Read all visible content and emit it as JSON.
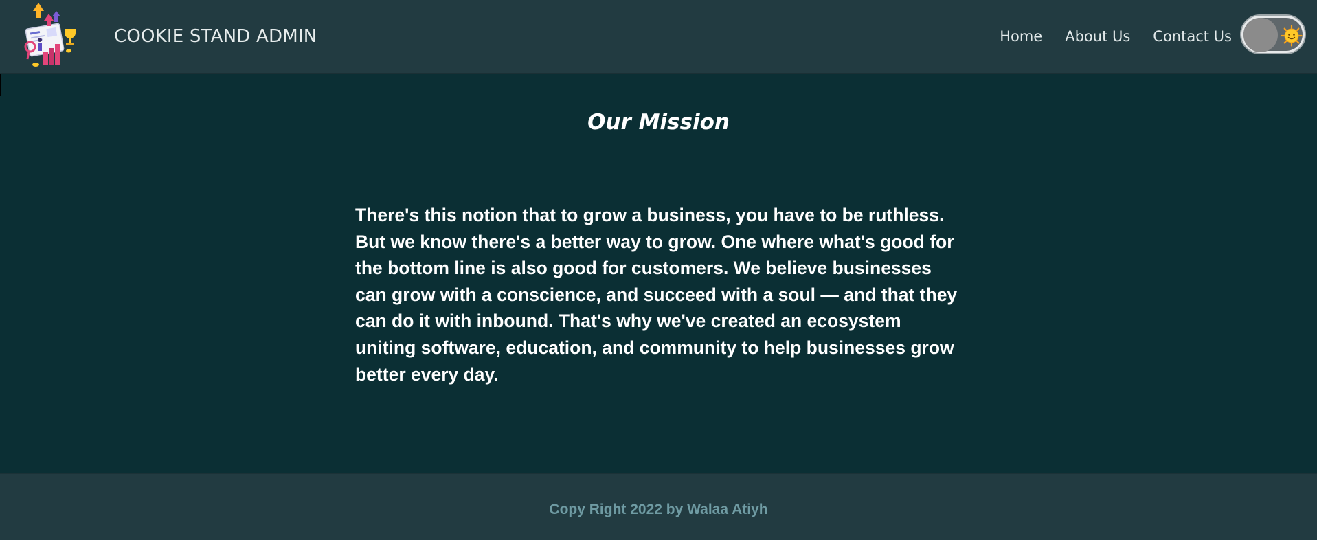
{
  "header": {
    "brand_title": "COOKIE STAND ADMIN",
    "logo_icon": "business-growth-illustration",
    "nav": [
      {
        "label": "Home"
      },
      {
        "label": "About Us"
      },
      {
        "label": "Contact Us"
      }
    ],
    "theme_toggle": {
      "state": "off",
      "icon": "sun-icon"
    }
  },
  "main": {
    "title": "Our Mission",
    "paragraph": "There's this notion that to grow a business, you have to be ruthless. But we know there's a better way to grow. One where what's good for the bottom line is also good for customers. We believe businesses can grow with a conscience, and succeed with a soul — and that they can do it with inbound. That's why we've created an ecosystem uniting software, education, and community to help businesses grow better every day."
  },
  "footer": {
    "copyright": "Copy Right 2022 by Walaa Atiyh"
  },
  "colors": {
    "header_bg": "#223b41",
    "main_bg": "#0b2f34",
    "footer_bg": "#223b41",
    "footer_text": "#6f9ba3"
  }
}
